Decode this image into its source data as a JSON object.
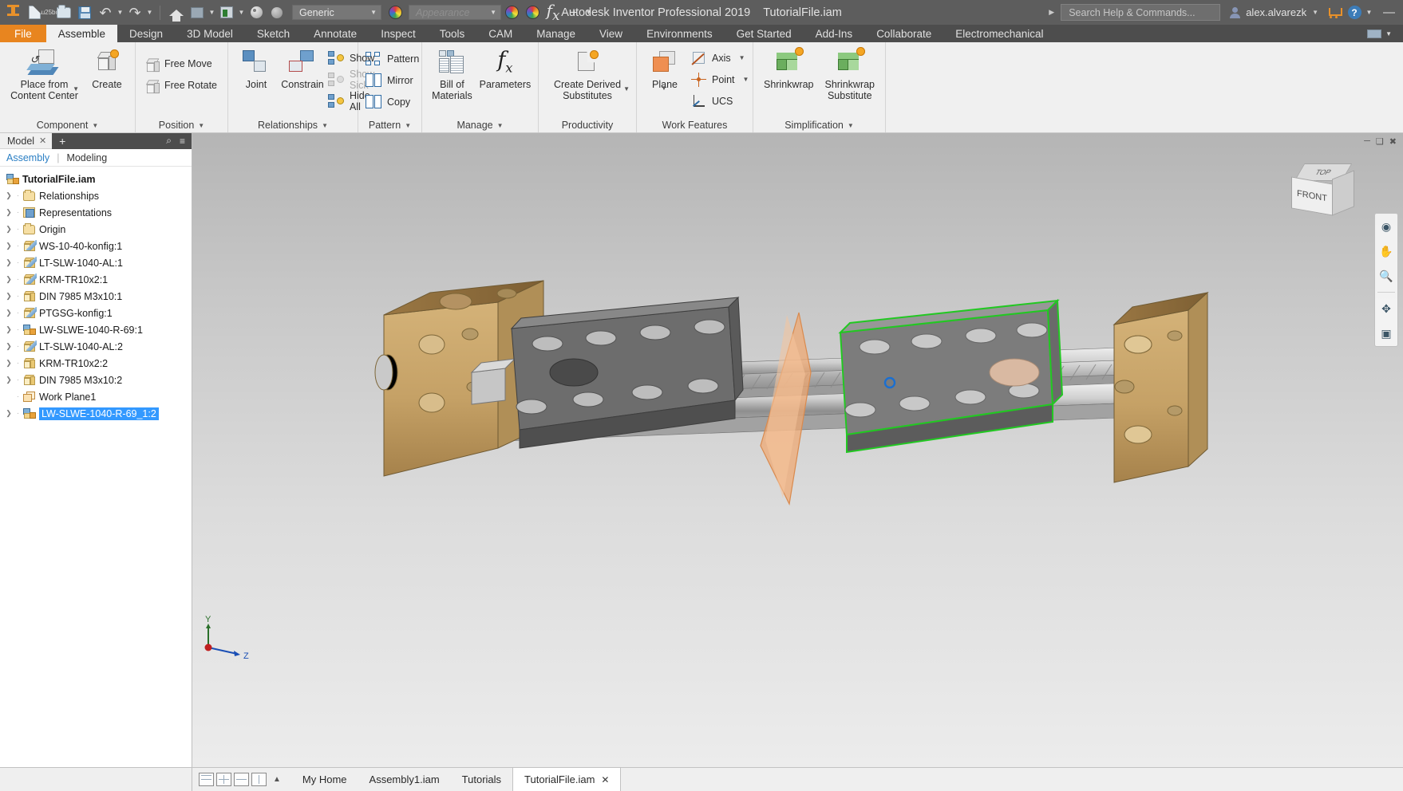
{
  "titlebar": {
    "app_title": "Autodesk Inventor Professional 2019",
    "document_title": "TutorialFile.iam",
    "search_placeholder": "Search Help & Commands...",
    "user_name": "alex.alvarezk",
    "material_dropdown": "Generic",
    "appearance_dropdown": "Appearance",
    "minimize_glyph": "—"
  },
  "ribbon_tabs": [
    {
      "label": "File",
      "type": "file"
    },
    {
      "label": "Assemble",
      "type": "active"
    },
    {
      "label": "Design",
      "type": "normal"
    },
    {
      "label": "3D Model",
      "type": "normal"
    },
    {
      "label": "Sketch",
      "type": "normal"
    },
    {
      "label": "Annotate",
      "type": "normal"
    },
    {
      "label": "Inspect",
      "type": "normal"
    },
    {
      "label": "Tools",
      "type": "normal"
    },
    {
      "label": "CAM",
      "type": "normal"
    },
    {
      "label": "Manage",
      "type": "normal"
    },
    {
      "label": "View",
      "type": "normal"
    },
    {
      "label": "Environments",
      "type": "normal"
    },
    {
      "label": "Get Started",
      "type": "normal"
    },
    {
      "label": "Add-Ins",
      "type": "normal"
    },
    {
      "label": "Collaborate",
      "type": "normal"
    },
    {
      "label": "Electromechanical",
      "type": "normal"
    }
  ],
  "ribbon": {
    "panels": {
      "component": {
        "label": "Component",
        "place_from_line1": "Place from",
        "place_from_line2": "Content Center",
        "create": "Create"
      },
      "position": {
        "label": "Position",
        "free_move": "Free Move",
        "free_rotate": "Free Rotate"
      },
      "relationships": {
        "label": "Relationships",
        "joint": "Joint",
        "constrain": "Constrain",
        "show": "Show",
        "show_sick": "Show Sick",
        "hide_all": "Hide All"
      },
      "pattern": {
        "label": "Pattern",
        "pattern": "Pattern",
        "mirror": "Mirror",
        "copy": "Copy"
      },
      "manage": {
        "label": "Manage",
        "bom_line1": "Bill of",
        "bom_line2": "Materials",
        "parameters": "Parameters"
      },
      "productivity": {
        "label": "Productivity",
        "derived_line1": "Create Derived",
        "derived_line2": "Substitutes"
      },
      "work_features": {
        "label": "Work Features",
        "plane": "Plane",
        "axis": "Axis",
        "point": "Point",
        "ucs": "UCS"
      },
      "simplification": {
        "label": "Simplification",
        "shrinkwrap": "Shrinkwrap",
        "shrinkwrap_sub_line1": "Shrinkwrap",
        "shrinkwrap_sub_line2": "Substitute"
      }
    }
  },
  "browser": {
    "tab_label": "Model",
    "close_glyph": "✕",
    "plus_glyph": "+",
    "search_glyph": "⌕",
    "menu_glyph": "≡",
    "sub_assembly": "Assembly",
    "sub_separator": "|",
    "sub_modeling": "Modeling",
    "tree": [
      {
        "label": "TutorialFile.iam",
        "icon": "assembly-icon",
        "indent": 0,
        "chevron": false,
        "root": true,
        "selected": false
      },
      {
        "label": "Relationships",
        "icon": "folder-icon",
        "indent": 1,
        "chevron": true,
        "root": false,
        "selected": false
      },
      {
        "label": "Representations",
        "icon": "representations-icon",
        "indent": 1,
        "chevron": true,
        "root": false,
        "selected": false
      },
      {
        "label": "Origin",
        "icon": "folder-icon",
        "indent": 1,
        "chevron": true,
        "root": false,
        "selected": false
      },
      {
        "label": "WS-10-40-konfig:1",
        "icon": "part-edit-icon",
        "indent": 1,
        "chevron": true,
        "root": false,
        "selected": false
      },
      {
        "label": "LT-SLW-1040-AL:1",
        "icon": "part-edit-icon",
        "indent": 1,
        "chevron": true,
        "root": false,
        "selected": false
      },
      {
        "label": "KRM-TR10x2:1",
        "icon": "part-edit-icon",
        "indent": 1,
        "chevron": true,
        "root": false,
        "selected": false
      },
      {
        "label": "DIN 7985 M3x10:1",
        "icon": "part-icon",
        "indent": 1,
        "chevron": true,
        "root": false,
        "selected": false
      },
      {
        "label": "PTGSG-konfig:1",
        "icon": "part-edit-icon",
        "indent": 1,
        "chevron": true,
        "root": false,
        "selected": false
      },
      {
        "label": "LW-SLWE-1040-R-69:1",
        "icon": "assembly-icon",
        "indent": 1,
        "chevron": true,
        "root": false,
        "selected": false
      },
      {
        "label": "LT-SLW-1040-AL:2",
        "icon": "part-edit-icon",
        "indent": 1,
        "chevron": true,
        "root": false,
        "selected": false
      },
      {
        "label": "KRM-TR10x2:2",
        "icon": "part-icon",
        "indent": 1,
        "chevron": true,
        "root": false,
        "selected": false
      },
      {
        "label": "DIN 7985 M3x10:2",
        "icon": "part-icon",
        "indent": 1,
        "chevron": true,
        "root": false,
        "selected": false
      },
      {
        "label": "Work Plane1",
        "icon": "work-plane-icon",
        "indent": 1,
        "chevron": false,
        "root": false,
        "selected": false
      },
      {
        "label": "LW-SLWE-1040-R-69_1:2",
        "icon": "assembly-icon",
        "indent": 1,
        "chevron": true,
        "root": false,
        "selected": true
      }
    ]
  },
  "viewport": {
    "viewcube_top": "TOP",
    "viewcube_front": "FRONT",
    "axis_y": "Y",
    "axis_z": "Z",
    "selection_color": "#1b6fd0",
    "highlight_color": "#22c822",
    "work_plane_color": "#e8a472",
    "nav_icons": [
      "full-navigation-wheel-icon",
      "pan-icon",
      "zoom-icon",
      "orbit-icon",
      "look-at-icon"
    ],
    "window_buttons": [
      "minimize-icon",
      "restore-icon",
      "close-icon"
    ]
  },
  "taskbar": {
    "layout_icons": [
      "tile-icon",
      "grid-icon",
      "horizontal-split-icon",
      "vertical-split-icon"
    ],
    "scroll_up_glyph": "▲",
    "documents": [
      {
        "label": "My Home",
        "active": false,
        "closable": false
      },
      {
        "label": "Assembly1.iam",
        "active": false,
        "closable": false
      },
      {
        "label": "Tutorials",
        "active": false,
        "closable": false
      },
      {
        "label": "TutorialFile.iam",
        "active": true,
        "closable": true
      }
    ],
    "close_glyph": "✕"
  }
}
